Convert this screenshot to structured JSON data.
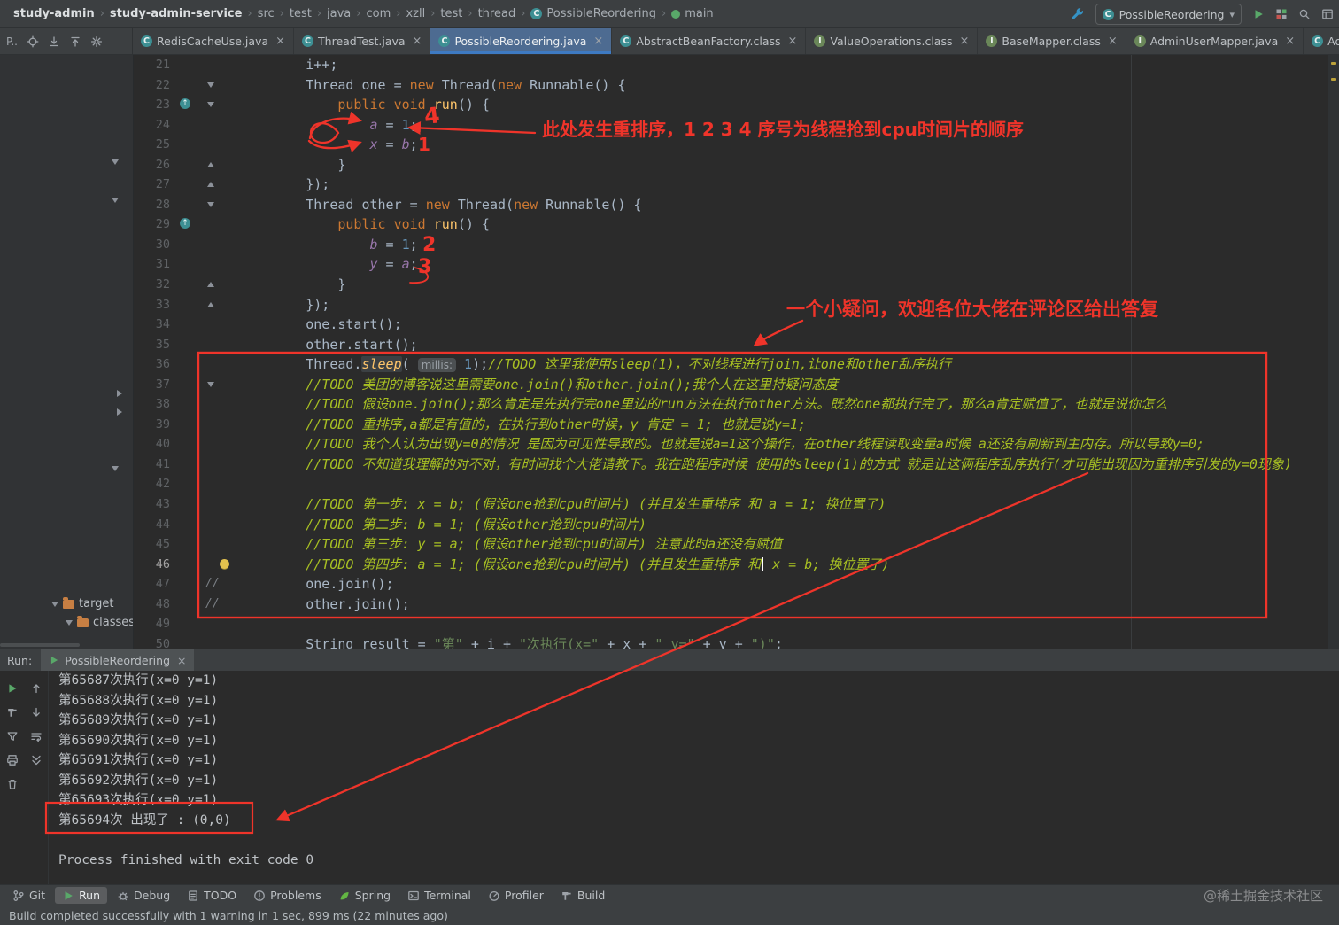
{
  "breadcrumb_bar": {
    "separator": "›",
    "items": [
      {
        "label": "study-admin",
        "bold": true
      },
      {
        "label": "study-admin-service",
        "bold": true
      },
      {
        "label": "src"
      },
      {
        "label": "test"
      },
      {
        "label": "java"
      },
      {
        "label": "com"
      },
      {
        "label": "xzll"
      },
      {
        "label": "test"
      },
      {
        "label": "thread"
      },
      {
        "label": "PossibleReordering",
        "icon": "class-c"
      },
      {
        "label": "main",
        "icon": "method-main"
      }
    ],
    "run_config": "PossibleReordering",
    "dropdown_glyph": "▾",
    "left_action": "wrench",
    "actions": [
      "run",
      "services",
      "search",
      "layout"
    ]
  },
  "tab_bar": {
    "panel_label": "P..",
    "panel_icons": [
      "locate",
      "expand",
      "collapse",
      "gear"
    ],
    "close_glyph": "×",
    "tabs": [
      {
        "label": "RedisCacheUse.java",
        "icon": "class-c",
        "close": true
      },
      {
        "label": "ThreadTest.java",
        "icon": "class-c",
        "close": true
      },
      {
        "label": "PossibleReordering.java",
        "icon": "class-c",
        "close": true,
        "active": true
      },
      {
        "label": "AbstractBeanFactory.class",
        "icon": "class-c",
        "close": true
      },
      {
        "label": "ValueOperations.class",
        "icon": "interface-i",
        "close": true
      },
      {
        "label": "BaseMapper.class",
        "icon": "interface-i",
        "close": true
      },
      {
        "label": "AdminUserMapper.java",
        "icon": "interface-i",
        "close": true
      },
      {
        "label": "AdminUserDO.java",
        "icon": "class-c",
        "close": false
      }
    ]
  },
  "project_panel": {
    "items": [
      {
        "label": "target",
        "icon": "folder"
      },
      {
        "label": "classes",
        "icon": "folder"
      }
    ]
  },
  "editor": {
    "lines": [
      {
        "num": 21,
        "icons": [],
        "tokens": [
          [
            "p",
            "        i++;"
          ]
        ]
      },
      {
        "num": 22,
        "icons": [
          "fold-down"
        ],
        "tokens": [
          [
            "p",
            "        Thread one = "
          ],
          [
            "k",
            "new"
          ],
          [
            "p",
            " Thread("
          ],
          [
            "k",
            "new"
          ],
          [
            "p",
            " Runnable() {"
          ]
        ]
      },
      {
        "num": 23,
        "icons": [
          "override",
          "fold-down"
        ],
        "tokens": [
          [
            "p",
            "            "
          ],
          [
            "k",
            "public void "
          ],
          [
            "m",
            "run"
          ],
          [
            "p",
            "() {"
          ]
        ]
      },
      {
        "num": 24,
        "icons": [],
        "tokens": [
          [
            "p",
            "                "
          ],
          [
            "f",
            "a"
          ],
          [
            "p",
            " = "
          ],
          [
            "n",
            "1"
          ],
          [
            "p",
            ";"
          ]
        ]
      },
      {
        "num": 25,
        "icons": [],
        "tokens": [
          [
            "p",
            "                "
          ],
          [
            "f",
            "x"
          ],
          [
            "p",
            " = "
          ],
          [
            "f",
            "b"
          ],
          [
            "p",
            ";"
          ]
        ]
      },
      {
        "num": 26,
        "icons": [
          "fold-up"
        ],
        "tokens": [
          [
            "p",
            "            }"
          ]
        ]
      },
      {
        "num": 27,
        "icons": [
          "fold-up"
        ],
        "tokens": [
          [
            "p",
            "        });"
          ]
        ]
      },
      {
        "num": 28,
        "icons": [
          "fold-down"
        ],
        "tokens": [
          [
            "p",
            "        Thread other = "
          ],
          [
            "k",
            "new"
          ],
          [
            "p",
            " Thread("
          ],
          [
            "k",
            "new"
          ],
          [
            "p",
            " Runnable() {"
          ]
        ]
      },
      {
        "num": 29,
        "icons": [
          "override"
        ],
        "tokens": [
          [
            "p",
            "            "
          ],
          [
            "k",
            "public void "
          ],
          [
            "m",
            "run"
          ],
          [
            "p",
            "() {"
          ]
        ]
      },
      {
        "num": 30,
        "icons": [],
        "tokens": [
          [
            "p",
            "                "
          ],
          [
            "f",
            "b"
          ],
          [
            "p",
            " = "
          ],
          [
            "n",
            "1"
          ],
          [
            "p",
            ";"
          ]
        ]
      },
      {
        "num": 31,
        "icons": [],
        "tokens": [
          [
            "p",
            "                "
          ],
          [
            "f",
            "y"
          ],
          [
            "p",
            " = "
          ],
          [
            "f",
            "a"
          ],
          [
            "p",
            ";"
          ]
        ]
      },
      {
        "num": 32,
        "icons": [
          "fold-up"
        ],
        "tokens": [
          [
            "p",
            "            }"
          ]
        ]
      },
      {
        "num": 33,
        "icons": [
          "fold-up"
        ],
        "tokens": [
          [
            "p",
            "        });"
          ]
        ]
      },
      {
        "num": 34,
        "icons": [],
        "tokens": [
          [
            "p",
            "        one.start();"
          ]
        ]
      },
      {
        "num": 35,
        "icons": [],
        "tokens": [
          [
            "p",
            "        other.start();"
          ]
        ]
      },
      {
        "num": 36,
        "icons": [],
        "tokens": [
          [
            "p",
            "        Thread."
          ],
          [
            "sm",
            "sleep"
          ],
          [
            "p",
            "( "
          ],
          [
            "h",
            "millis:"
          ],
          [
            "p",
            " "
          ],
          [
            "n",
            "1"
          ],
          [
            "p",
            ");"
          ],
          [
            "td",
            "//TODO 这里我使用sleep(1)，不对线程进行join,让one和other乱序执行"
          ]
        ]
      },
      {
        "num": 37,
        "icons": [
          "fold-down"
        ],
        "tokens": [
          [
            "p",
            "        "
          ],
          [
            "td",
            "//TODO 美团的博客说这里需要one.join()和other.join();我个人在这里持疑问态度"
          ]
        ]
      },
      {
        "num": 38,
        "icons": [],
        "tokens": [
          [
            "p",
            "        "
          ],
          [
            "td",
            "//TODO 假设one.join();那么肯定是先执行完one里边的run方法在执行other方法。既然one都执行完了，那么a肯定赋值了，也就是说你怎么"
          ]
        ]
      },
      {
        "num": 39,
        "icons": [],
        "tokens": [
          [
            "p",
            "        "
          ],
          [
            "td",
            "//TODO 重排序,a都是有值的，在执行到other时候，y 肯定 = 1; 也就是说y=1;"
          ]
        ]
      },
      {
        "num": 40,
        "icons": [],
        "tokens": [
          [
            "p",
            "        "
          ],
          [
            "td",
            "//TODO 我个人认为出现y=0的情况 是因为可见性导致的。也就是说a=1这个操作，在other线程读取变量a时候 a还没有刷新到主内存。所以导致y=0;"
          ]
        ]
      },
      {
        "num": 41,
        "icons": [],
        "tokens": [
          [
            "p",
            "        "
          ],
          [
            "td",
            "//TODO 不知道我理解的对不对，有时间找个大佬请教下。我在跑程序时候 使用的sleep(1)的方式 就是让这俩程序乱序执行(才可能出现因为重排序引发的y=0现象)"
          ]
        ]
      },
      {
        "num": 42,
        "icons": [],
        "tokens": []
      },
      {
        "num": 43,
        "icons": [],
        "tokens": [
          [
            "p",
            "        "
          ],
          [
            "td",
            "//TODO 第一步: x = b; (假设one抢到cpu时间片) (并且发生重排序 和 a = 1; 换位置了)"
          ]
        ]
      },
      {
        "num": 44,
        "icons": [],
        "tokens": [
          [
            "p",
            "        "
          ],
          [
            "td",
            "//TODO 第二步: b = 1; (假设other抢到cpu时间片)"
          ]
        ]
      },
      {
        "num": 45,
        "icons": [],
        "tokens": [
          [
            "p",
            "        "
          ],
          [
            "td",
            "//TODO 第三步: y = a; (假设other抢到cpu时间片) 注意此时a还没有赋值"
          ]
        ]
      },
      {
        "num": 46,
        "cur": true,
        "icons": [
          "bulb"
        ],
        "tokens": [
          [
            "p",
            "        "
          ],
          [
            "td",
            "//TODO 第四步: a = 1; (假设one抢到cpu时间片) (并且发生重排序 和"
          ],
          [
            "caret",
            ""
          ],
          [
            "td",
            " x = b; 换位置了)"
          ]
        ]
      },
      {
        "num": 47,
        "icons": [
          "cmt"
        ],
        "tokens": [
          [
            "p",
            "        one.join();"
          ]
        ]
      },
      {
        "num": 48,
        "icons": [
          "cmt"
        ],
        "tokens": [
          [
            "p",
            "        other.join();"
          ]
        ]
      },
      {
        "num": 49,
        "icons": [],
        "tokens": []
      },
      {
        "num": 50,
        "icons": [],
        "tokens": [
          [
            "p",
            "        String result = "
          ],
          [
            "s",
            "\"第\""
          ],
          [
            "p",
            " + i + "
          ],
          [
            "s",
            "\"次执行(x=\""
          ],
          [
            "p",
            " + x + "
          ],
          [
            "s",
            "\" y=\""
          ],
          [
            "p",
            " + y + "
          ],
          [
            "s",
            "\")\""
          ],
          [
            "p",
            ";"
          ]
        ]
      }
    ]
  },
  "run_panel": {
    "label": "Run:",
    "tab_label": "PossibleReordering",
    "tab_icon": "run-tab",
    "close_glyph": "×",
    "toolbar": [
      "rerun",
      "navigate-up",
      "build",
      "navigate-down",
      "filter",
      "soft-wrap",
      "print",
      "scroll-end",
      "clear"
    ],
    "output": [
      "第65687次执行(x=0 y=1)",
      "第65688次执行(x=0 y=1)",
      "第65689次执行(x=0 y=1)",
      "第65690次执行(x=0 y=1)",
      "第65691次执行(x=0 y=1)",
      "第65692次执行(x=0 y=1)",
      "第65693次执行(x=0 y=1)",
      "第65694次 出现了 : (0,0)",
      "",
      "Process finished with exit code 0"
    ]
  },
  "bottom_bar": {
    "items": [
      {
        "label": "Git",
        "icon": "git"
      },
      {
        "label": "Run",
        "icon": "run",
        "active": true
      },
      {
        "label": "Debug",
        "icon": "debug"
      },
      {
        "label": "TODO",
        "icon": "todo"
      },
      {
        "label": "Problems",
        "icon": "problems"
      },
      {
        "label": "Spring",
        "icon": "spring"
      },
      {
        "label": "Terminal",
        "icon": "terminal"
      },
      {
        "label": "Profiler",
        "icon": "profiler"
      },
      {
        "label": "Build",
        "icon": "build"
      }
    ],
    "watermark": "@稀土掘金技术社区"
  },
  "status_bar": {
    "message": "Build completed successfully with 1 warning in 1 sec, 899 ms (22 minutes ago)"
  },
  "annotations": {
    "accent_color": "#ef342a",
    "note1": "此处发生重排序，1 2 3 4 序号为线程抢到cpu时间片的顺序",
    "note2": "一个小疑问，欢迎各位大佬在评论区给出答复",
    "digits": [
      "4",
      "1",
      "2",
      "3"
    ]
  }
}
